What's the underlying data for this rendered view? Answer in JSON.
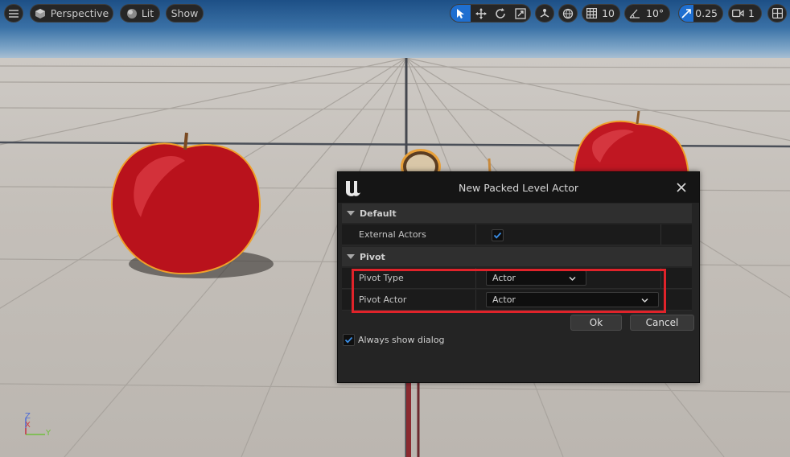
{
  "toolbar": {
    "menu_icon": "hamburger-icon",
    "view_mode": "Perspective",
    "lit_mode": "Lit",
    "show_label": "Show",
    "grid_snap": "10",
    "rotation_snap": "10°",
    "scale_snap": "0.25",
    "camera_speed": "1"
  },
  "dialog": {
    "title": "New Packed Level Actor",
    "sections": {
      "default": {
        "label": "Default",
        "rows": {
          "external_actors": {
            "label": "External Actors",
            "checked": true
          }
        }
      },
      "pivot": {
        "label": "Pivot",
        "rows": {
          "pivot_type": {
            "label": "Pivot Type",
            "value": "Actor"
          },
          "pivot_actor": {
            "label": "Pivot Actor",
            "value": "Actor"
          }
        }
      }
    },
    "ok_label": "Ok",
    "cancel_label": "Cancel",
    "always_show": {
      "label": "Always show dialog",
      "checked": true
    }
  },
  "axes": {
    "z": "Z",
    "x": "X",
    "y": "Y"
  },
  "colors": {
    "accent": "#1f6fd0",
    "highlight": "#e0232a",
    "dialog_bg": "#242424"
  }
}
